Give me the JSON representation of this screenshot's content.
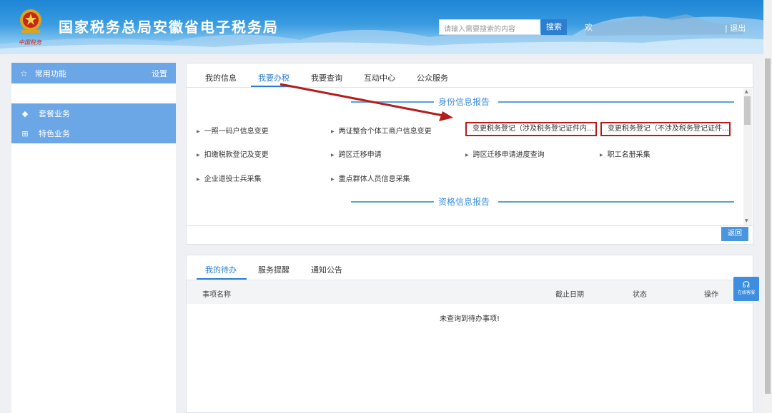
{
  "header": {
    "title": "国家税务总局安徽省电子税务局",
    "search_placeholder": "请输入需要搜索的内容",
    "search_button": "搜索",
    "welcome": "欢",
    "logout": "| 退出",
    "emblem_caption": "中国税务"
  },
  "sidebar": {
    "common_functions": "常用功能",
    "settings": "设置",
    "items": [
      {
        "label": "套餐业务",
        "icon": "layers-icon"
      },
      {
        "label": "特色业务",
        "icon": "grid-icon"
      }
    ]
  },
  "main_tabs": [
    "我的信息",
    "我要办税",
    "我要查询",
    "互动中心",
    "公众服务"
  ],
  "active_tab": "我要办税",
  "sections": {
    "identity": "身份信息报告",
    "qualification": "资格信息报告"
  },
  "identity_items": [
    "一照一码户信息变更",
    "两证整合个体工商户信息变更",
    "变更税务登记（涉及税务登记证件内...",
    "变更税务登记（不涉及税务登记证件...",
    "扣缴税款登记及变更",
    "跨区迁移申请",
    "跨区迁移申请进度查询",
    "职工名册采集",
    "企业退役士兵采集",
    "重点群体人员信息采集"
  ],
  "return_button": "返回",
  "todo": {
    "tabs": [
      "我的待办",
      "服务提醒",
      "通知公告"
    ],
    "active_tab": "我的待办",
    "columns": [
      "事项名称",
      "截止日期",
      "状态",
      "操作"
    ],
    "empty_message": "未查询到待办事项!"
  },
  "online_service": "在线客服",
  "colors": {
    "accent": "#2b7fd1",
    "sidebar": "#6ba6e6",
    "highlight_box": "#b51c1c"
  }
}
